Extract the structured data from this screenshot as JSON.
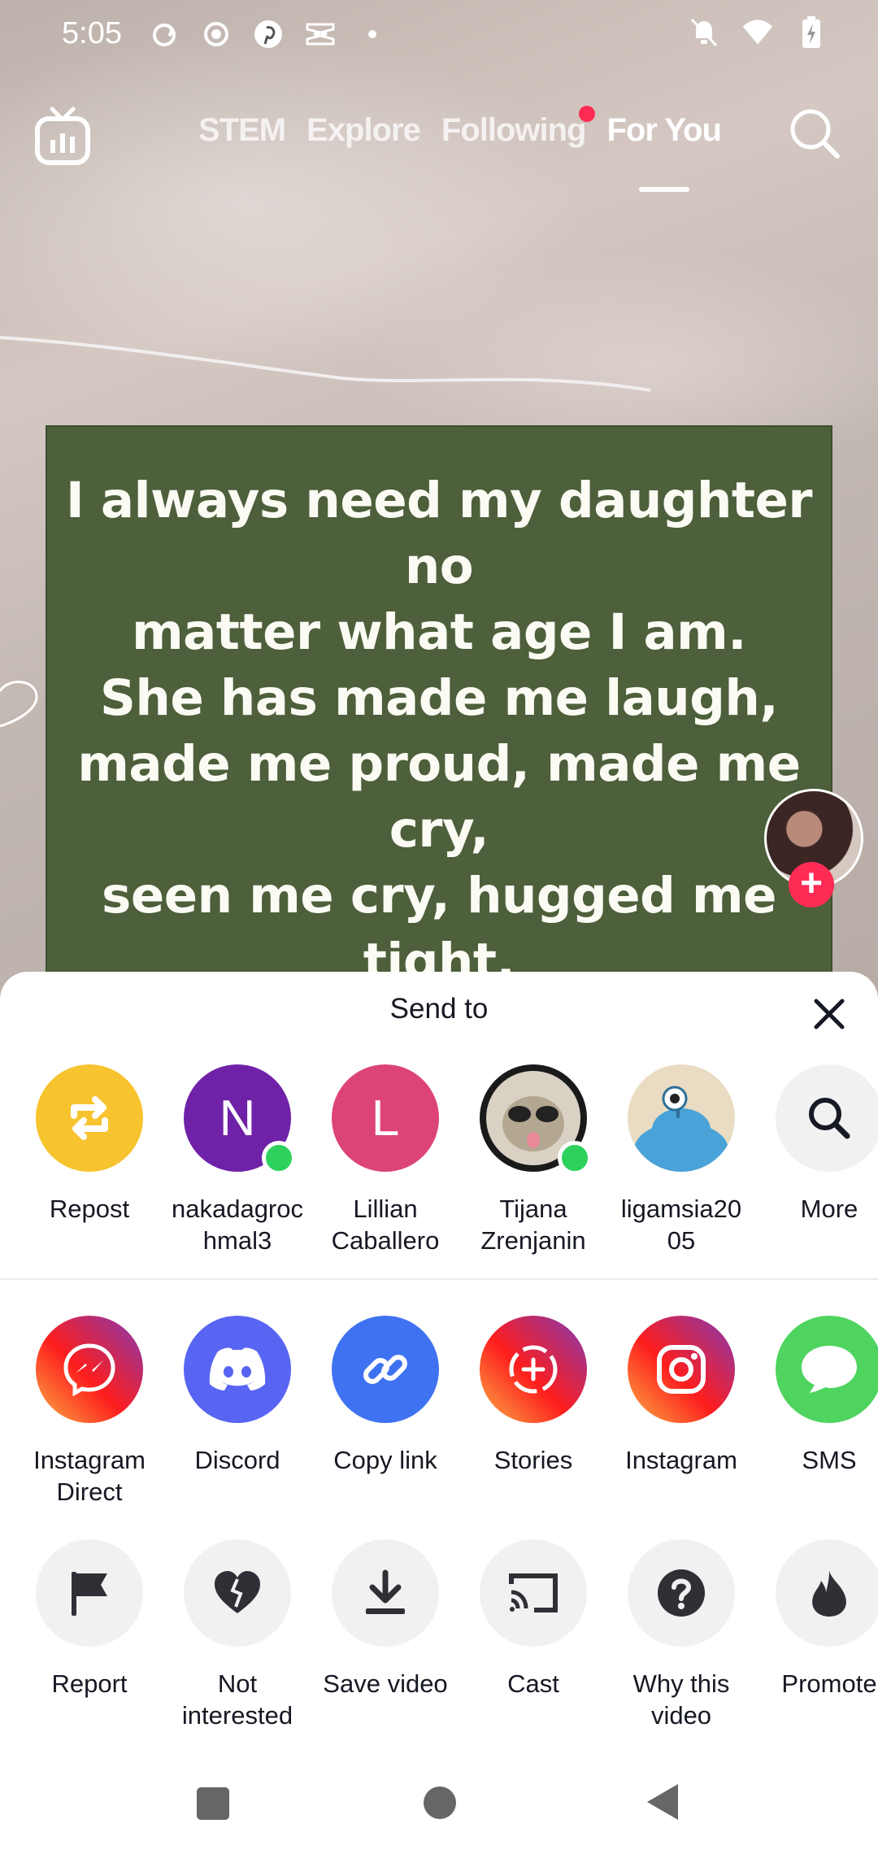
{
  "status_bar": {
    "time": "5:05",
    "left_icons": [
      "threads-icon",
      "record-icon",
      "pinterest-icon",
      "capcut-icon",
      "dot-icon"
    ],
    "right_icons": [
      "bell-off-icon",
      "wifi-icon",
      "battery-charging-icon"
    ]
  },
  "top_nav": {
    "tabs": [
      {
        "label": "STEM",
        "active": false
      },
      {
        "label": "Explore",
        "active": false
      },
      {
        "label": "Following",
        "active": false,
        "has_dot": true
      },
      {
        "label": "For You",
        "active": true
      }
    ]
  },
  "video": {
    "quote": "I always need my daughter no\nmatter what age I am.\nShe has made me laugh,\nmade me proud, made me cry,\nseen me cry, hugged me tight,\nseen me fail, cheered me up,\nkept me on my toes and has\ndriven me crazy at times."
  },
  "sheet": {
    "title": "Send to",
    "contacts": [
      {
        "label": "Repost",
        "color": "#f7c32e",
        "icon": "repost-icon"
      },
      {
        "label": "nakadagroc\nhmal3",
        "initial": "N",
        "color": "#6f22a8",
        "online": true
      },
      {
        "label": "Lillian\nCaballero",
        "initial": "L",
        "color": "#dc4378",
        "online": false
      },
      {
        "label": "Tijana\nZrenjanin",
        "online": true
      },
      {
        "label": "ligamsia20\n05",
        "online": false
      },
      {
        "label": "More",
        "color": "#f1f1f2",
        "icon": "search-icon"
      }
    ],
    "share_apps": [
      {
        "label": "Instagram\nDirect",
        "icon": "messenger-icon"
      },
      {
        "label": "Discord",
        "color": "#5865f2",
        "icon": "discord-icon"
      },
      {
        "label": "Copy link",
        "color": "#3f72f0",
        "icon": "link-icon"
      },
      {
        "label": "Stories",
        "icon": "stories-icon"
      },
      {
        "label": "Instagram",
        "icon": "instagram-icon"
      },
      {
        "label": "SMS",
        "color": "#4fd45f",
        "icon": "sms-icon"
      }
    ],
    "actions": [
      {
        "label": "Report",
        "icon": "flag-icon"
      },
      {
        "label": "Not\ninterested",
        "icon": "broken-heart-icon"
      },
      {
        "label": "Save video",
        "icon": "download-icon"
      },
      {
        "label": "Cast",
        "icon": "cast-icon"
      },
      {
        "label": "Why this\nvideo",
        "icon": "question-icon"
      },
      {
        "label": "Promote",
        "icon": "flame-icon"
      }
    ]
  },
  "nav_bar": {
    "buttons": [
      "recents-button",
      "home-button",
      "back-button"
    ]
  }
}
